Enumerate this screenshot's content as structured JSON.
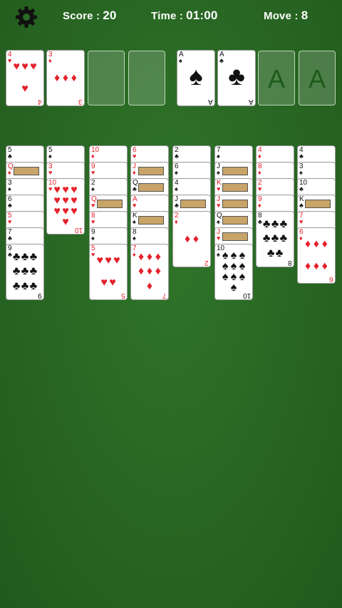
{
  "hud": {
    "score_label": "Score :",
    "score_value": "20",
    "time_label": "Time :",
    "time_value": "01:00",
    "move_label": "Move :",
    "move_value": "8",
    "settings_icon": "gear-icon"
  },
  "freecells": [
    {
      "rank": "4",
      "suit": "♥",
      "color": "red"
    },
    {
      "rank": "3",
      "suit": "♦",
      "color": "red"
    },
    null,
    null
  ],
  "foundations": [
    {
      "rank": "A",
      "suit": "♠",
      "color": "black"
    },
    {
      "rank": "A",
      "suit": "♣",
      "color": "black"
    },
    {
      "placeholder": "A"
    },
    {
      "placeholder": "A"
    }
  ],
  "columns": [
    [
      [
        "5",
        "♣"
      ],
      [
        "Q",
        "♦"
      ],
      [
        "3",
        "♠"
      ],
      [
        "6",
        "♣"
      ],
      [
        "5",
        "♥"
      ],
      [
        "7",
        "♣"
      ],
      [
        "9",
        "♣"
      ]
    ],
    [
      [
        "5",
        "♠"
      ],
      [
        "3",
        "♥"
      ],
      [
        "10",
        "♥"
      ]
    ],
    [
      [
        "10",
        "♦"
      ],
      [
        "9",
        "♥"
      ],
      [
        "2",
        "♠"
      ],
      [
        "Q",
        "♥"
      ],
      [
        "8",
        "♥"
      ],
      [
        "9",
        "♠"
      ],
      [
        "5",
        "♥"
      ]
    ],
    [
      [
        "6",
        "♥"
      ],
      [
        "J",
        "♦"
      ],
      [
        "Q",
        "♣"
      ],
      [
        "A",
        "♥"
      ],
      [
        "K",
        "♠"
      ],
      [
        "8",
        "♠"
      ],
      [
        "7",
        "♦"
      ]
    ],
    [
      [
        "2",
        "♣"
      ],
      [
        "6",
        "♠"
      ],
      [
        "4",
        "♠"
      ],
      [
        "J",
        "♣"
      ],
      [
        "2",
        "♦"
      ]
    ],
    [
      [
        "7",
        "♠"
      ],
      [
        "J",
        "♠"
      ],
      [
        "K",
        "♥"
      ],
      [
        "J",
        "♥"
      ],
      [
        "Q",
        "♠"
      ],
      [
        "J",
        "♥"
      ],
      [
        "10",
        "♠"
      ]
    ],
    [
      [
        "4",
        "♦"
      ],
      [
        "8",
        "♦"
      ],
      [
        "2",
        "♥"
      ],
      [
        "9",
        "♦"
      ],
      [
        "8",
        "♣"
      ]
    ],
    [
      [
        "4",
        "♣"
      ],
      [
        "3",
        "♠"
      ],
      [
        "10",
        "♣"
      ],
      [
        "K",
        "♣"
      ],
      [
        "7",
        "♥"
      ],
      [
        "6",
        "♦"
      ]
    ]
  ]
}
